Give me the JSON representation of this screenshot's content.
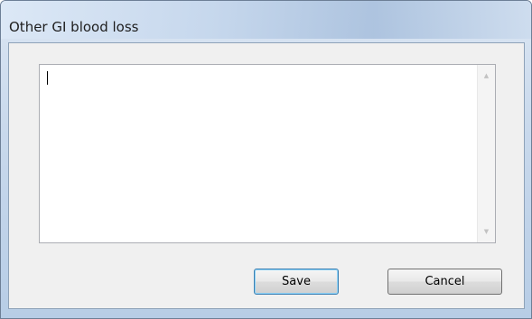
{
  "window": {
    "title": "Other GI blood loss"
  },
  "editor": {
    "value": ""
  },
  "buttons": {
    "save_label": "Save",
    "cancel_label": "Cancel"
  },
  "icons": {
    "scroll_up": "scroll-up-arrow-icon",
    "scroll_down": "scroll-down-arrow-icon"
  }
}
